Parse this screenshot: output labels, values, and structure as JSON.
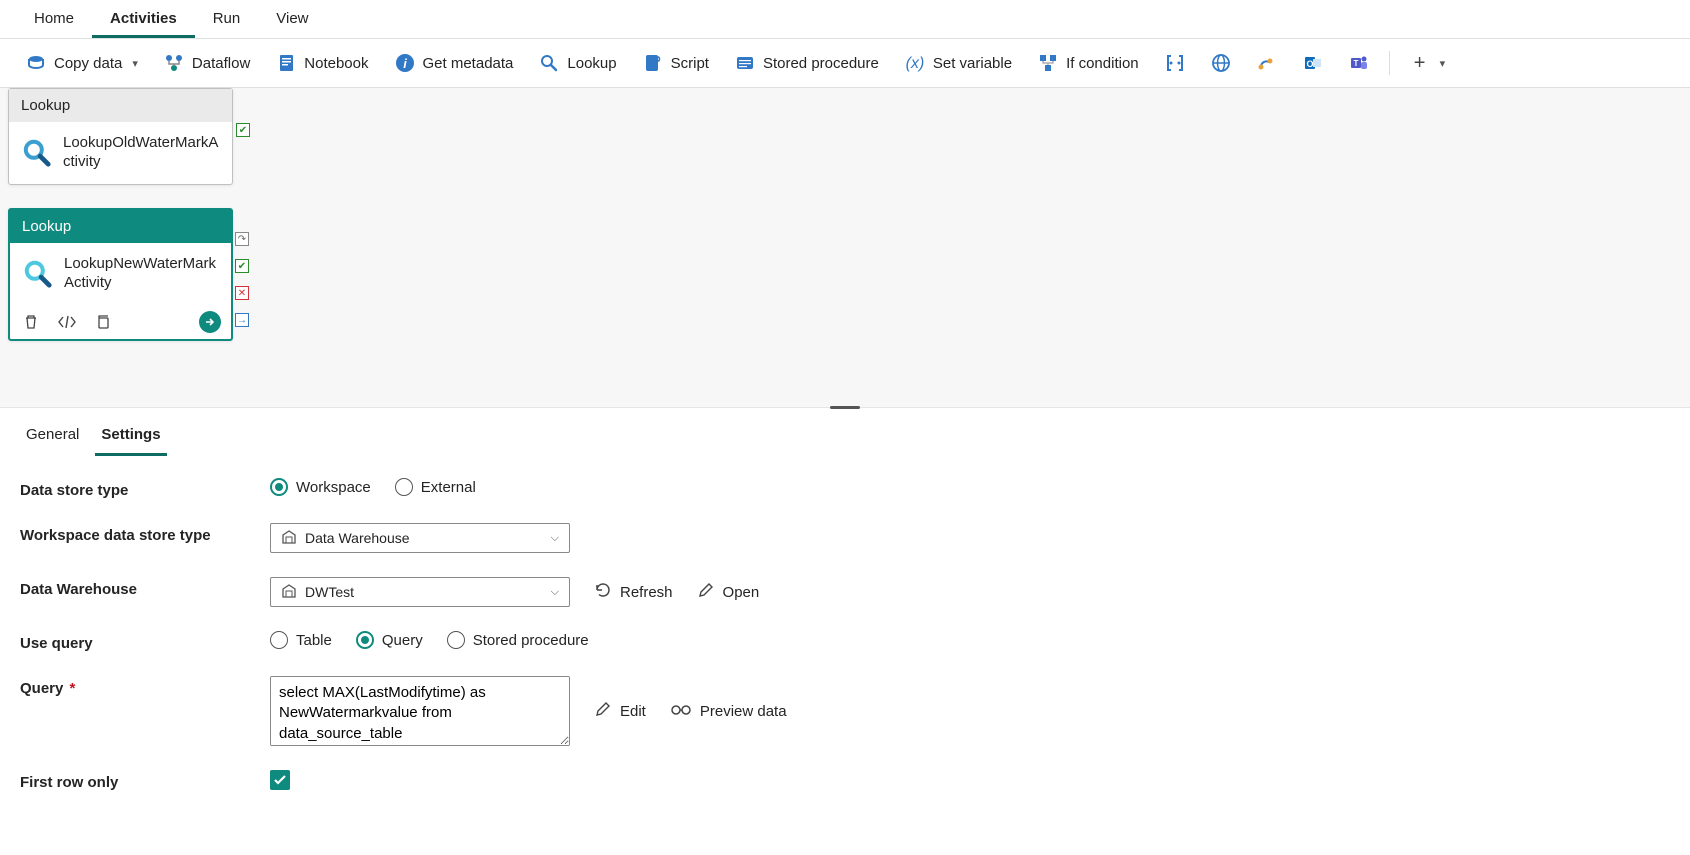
{
  "topTabs": {
    "items": [
      "Home",
      "Activities",
      "Run",
      "View"
    ],
    "active": 1
  },
  "toolbar": {
    "copyData": "Copy data",
    "dataflow": "Dataflow",
    "notebook": "Notebook",
    "getMetadata": "Get metadata",
    "lookup": "Lookup",
    "script": "Script",
    "storedProc": "Stored procedure",
    "setVar": "Set variable",
    "ifCond": "If condition"
  },
  "canvas": {
    "act1": {
      "type": "Lookup",
      "name": "LookupOldWaterMarkActivity"
    },
    "act2": {
      "type": "Lookup",
      "name": "LookupNewWaterMarkActivity"
    }
  },
  "detailTabs": {
    "general": "General",
    "settings": "Settings",
    "active": 1
  },
  "form": {
    "labels": {
      "dataStoreType": "Data store type",
      "wsDataStoreType": "Workspace data store type",
      "dataWarehouse": "Data Warehouse",
      "useQuery": "Use query",
      "query": "Query",
      "firstRowOnly": "First row only"
    },
    "dataStoreType": {
      "options": {
        "workspace": "Workspace",
        "external": "External"
      },
      "selected": "workspace"
    },
    "wsDataStoreType": {
      "value": "Data Warehouse"
    },
    "dataWarehouse": {
      "value": "DWTest",
      "actions": {
        "refresh": "Refresh",
        "open": "Open"
      }
    },
    "useQuery": {
      "options": {
        "table": "Table",
        "query": "Query",
        "sp": "Stored procedure"
      },
      "selected": "query"
    },
    "query": {
      "value": "select MAX(LastModifytime) as NewWatermarkvalue from data_source_table",
      "actions": {
        "edit": "Edit",
        "preview": "Preview data"
      }
    },
    "firstRowOnly": true
  }
}
